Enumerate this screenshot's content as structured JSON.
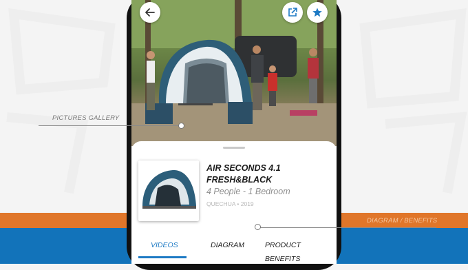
{
  "colors": {
    "accent_orange": "#e0762a",
    "accent_blue": "#1273ba",
    "tab_active": "#1e7ac4"
  },
  "header": {
    "back_icon": "arrow-left-icon",
    "share_icon": "external-link-icon",
    "favorite_icon": "star-icon"
  },
  "annotations": {
    "gallery": "PICTURES GALLERY",
    "diagram": "DIAGRAM / BENEFITS"
  },
  "product": {
    "name": "AIR SECONDS 4.1 FRESH&BLACK",
    "subtitle": "4 People - 1 Bedroom",
    "brand": "QUECHUA • 2019"
  },
  "tabs": [
    {
      "label": "VIDEOS",
      "active": true
    },
    {
      "label": "DIAGRAM",
      "active": false
    },
    {
      "label": "PRODUCT BENEFITS",
      "active": false
    }
  ]
}
